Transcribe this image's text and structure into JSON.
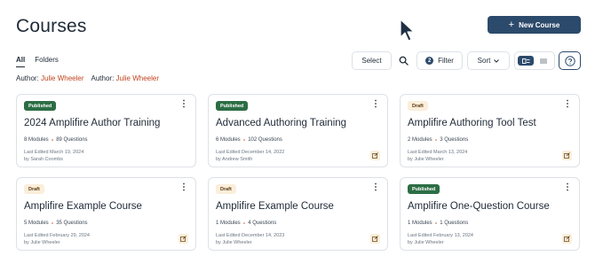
{
  "header": {
    "title": "Courses",
    "new_course_label": "New Course"
  },
  "tabs": [
    {
      "label": "All",
      "active": true
    },
    {
      "label": "Folders",
      "active": false
    }
  ],
  "toolbar": {
    "select_label": "Select",
    "filter_label": "Filter",
    "filter_count": "2",
    "sort_label": "Sort"
  },
  "active_filters": [
    {
      "label": "Author:",
      "value": "Julie Wheeler"
    },
    {
      "label": "Author:",
      "value": "Julie Wheeler"
    }
  ],
  "courses": [
    {
      "status": "Published",
      "title": "2024 Amplifire Author Training",
      "modules": "8 Modules",
      "questions": "89 Questions",
      "edited": "Last Edited March 19, 2024",
      "by": "by Sarah Coombs"
    },
    {
      "status": "Published",
      "title": "Advanced Authoring Training",
      "modules": "6 Modules",
      "questions": "102 Questions",
      "edited": "Last Edited December 14, 2022",
      "by": "by Andrew Smith"
    },
    {
      "status": "Draft",
      "title": "Amplifire Authoring Tool Test",
      "modules": "2 Modules",
      "questions": "3 Questions",
      "edited": "Last Edited March 13, 2024",
      "by": "by Julie Wheeler"
    },
    {
      "status": "Draft",
      "title": "Amplifire Example Course",
      "modules": "5 Modules",
      "questions": "35 Questions",
      "edited": "Last Edited February 29, 2024",
      "by": "by Julie Wheeler"
    },
    {
      "status": "Draft",
      "title": "Amplifire Example Course",
      "modules": "1 Modules",
      "questions": "4 Questions",
      "edited": "Last Edited December 14, 2023",
      "by": "by Julie Wheeler"
    },
    {
      "status": "Published",
      "title": "Amplifire One-Question Course",
      "modules": "1 Modules",
      "questions": "1 Questions",
      "edited": "Last Edited February 13, 2024",
      "by": "by Julie Wheeler"
    }
  ],
  "colors": {
    "primary": "#2c4a6b",
    "published": "#2d6e45",
    "draft_bg": "#fbeeda",
    "filter_value": "#c0441e"
  }
}
